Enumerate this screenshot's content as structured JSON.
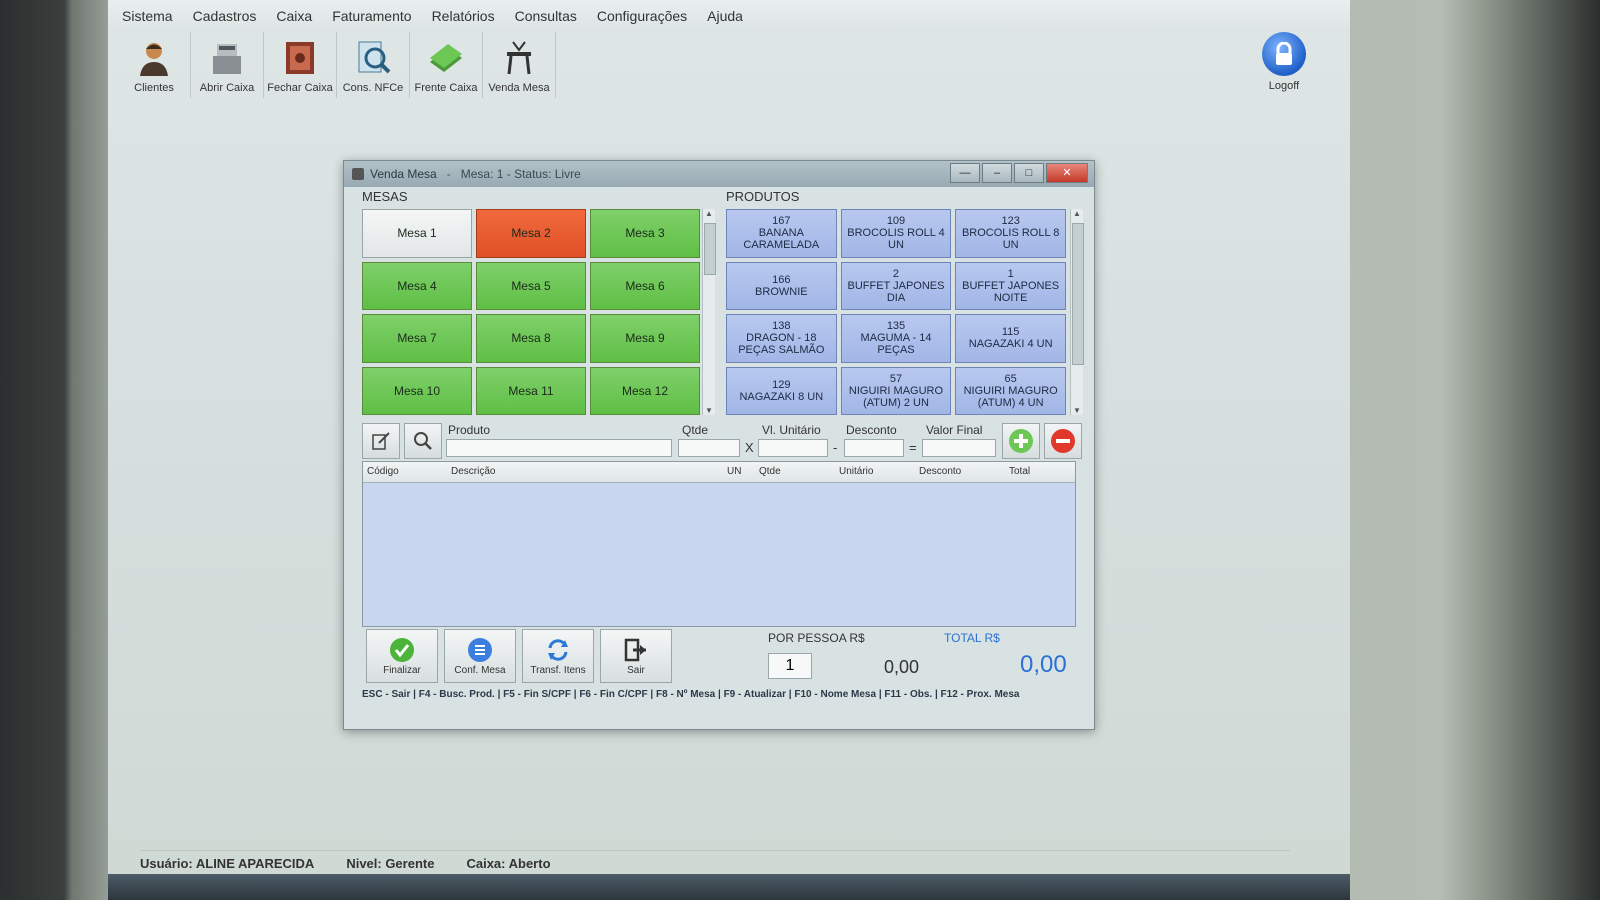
{
  "menu": [
    "Sistema",
    "Cadastros",
    "Caixa",
    "Faturamento",
    "Relatórios",
    "Consultas",
    "Configurações",
    "Ajuda"
  ],
  "toolbar": [
    {
      "label": "Clientes",
      "icon": "person-icon"
    },
    {
      "label": "Abrir Caixa",
      "icon": "cash-register-icon"
    },
    {
      "label": "Fechar Caixa",
      "icon": "safe-icon"
    },
    {
      "label": "Cons. NFCe",
      "icon": "document-magnifier-icon"
    },
    {
      "label": "Frente Caixa",
      "icon": "money-icon"
    },
    {
      "label": "Venda Mesa",
      "icon": "table-icon"
    }
  ],
  "logoff": {
    "label": "Logoff",
    "icon": "lock-icon"
  },
  "dialog": {
    "title": "Venda Mesa",
    "separator": "-",
    "status": "Mesa: 1 - Status: Livre",
    "mesas_label": "MESAS",
    "produtos_label": "PRODUTOS",
    "mesas": [
      {
        "label": "Mesa 1",
        "state": "free"
      },
      {
        "label": "Mesa 2",
        "state": "busy"
      },
      {
        "label": "Mesa 3",
        "state": "available"
      },
      {
        "label": "Mesa 4",
        "state": "available"
      },
      {
        "label": "Mesa 5",
        "state": "available"
      },
      {
        "label": "Mesa 6",
        "state": "available"
      },
      {
        "label": "Mesa 7",
        "state": "available"
      },
      {
        "label": "Mesa 8",
        "state": "available"
      },
      {
        "label": "Mesa 9",
        "state": "available"
      },
      {
        "label": "Mesa 10",
        "state": "available"
      },
      {
        "label": "Mesa 11",
        "state": "available"
      },
      {
        "label": "Mesa 12",
        "state": "available"
      }
    ],
    "produtos": [
      {
        "code": "167",
        "name": "BANANA CARAMELADA"
      },
      {
        "code": "109",
        "name": "BROCOLIS ROLL 4 UN"
      },
      {
        "code": "123",
        "name": "BROCOLIS ROLL 8 UN"
      },
      {
        "code": "166",
        "name": "BROWNIE"
      },
      {
        "code": "2",
        "name": "BUFFET JAPONES DIA"
      },
      {
        "code": "1",
        "name": "BUFFET JAPONES NOITE"
      },
      {
        "code": "138",
        "name": "DRAGON - 18 PEÇAS SALMÃO"
      },
      {
        "code": "135",
        "name": "MAGUMA - 14 PEÇAS"
      },
      {
        "code": "115",
        "name": "NAGAZAKI 4 UN"
      },
      {
        "code": "129",
        "name": "NAGAZAKI 8 UN"
      },
      {
        "code": "57",
        "name": "NIGUIRI MAGURO (ATUM) 2 UN"
      },
      {
        "code": "65",
        "name": "NIGUIRI MAGURO (ATUM) 4 UN"
      }
    ],
    "entry": {
      "produto_label": "Produto",
      "qtde_label": "Qtde",
      "vl_unitario_label": "Vl. Unitário",
      "desconto_label": "Desconto",
      "valor_final_label": "Valor Final",
      "op_x": "X",
      "op_minus": "-",
      "op_eq": "="
    },
    "table_headers": [
      "Código",
      "Descrição",
      "UN",
      "Qtde",
      "Unitário",
      "Desconto",
      "Total"
    ],
    "actions": [
      {
        "label": "Finalizar",
        "icon": "check-icon"
      },
      {
        "label": "Conf. Mesa",
        "icon": "list-icon"
      },
      {
        "label": "Transf. Itens",
        "icon": "transfer-icon"
      },
      {
        "label": "Sair",
        "icon": "exit-icon"
      }
    ],
    "por_pessoa_label": "POR PESSOA R$",
    "pessoas": "1",
    "por_pessoa_value": "0,00",
    "total_label": "TOTAL R$",
    "total_value": "0,00",
    "shortcuts": "ESC - Sair | F4 - Busc. Prod. | F5 - Fin S/CPF | F6 - Fin C/CPF | F8 - Nº Mesa | F9 - Atualizar | F10 - Nome Mesa | F11 - Obs. | F12 - Prox. Mesa"
  },
  "statusbar": {
    "usuario": "Usuário: ALINE APARECIDA",
    "nivel": "Nivel: Gerente",
    "caixa": "Caixa: Aberto"
  },
  "colors": {
    "mesa_free": "#eef1f1",
    "mesa_busy": "#e8592f",
    "mesa_available": "#6cc755",
    "produto": "#a9bbe9",
    "total_blue": "#2a6fd6"
  }
}
